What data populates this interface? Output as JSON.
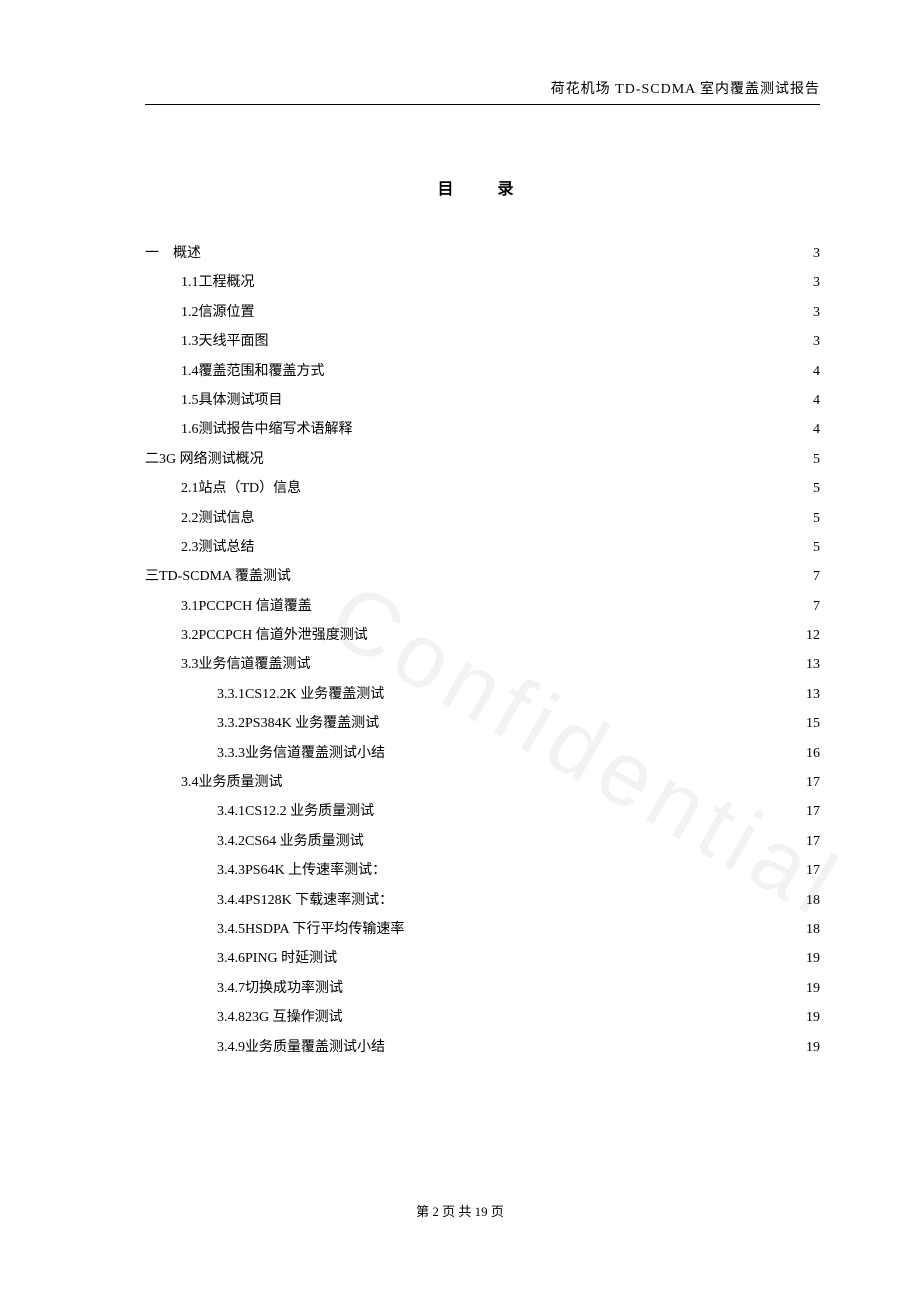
{
  "header": {
    "right_text": "荷花机场 TD-SCDMA 室内覆盖测试报告"
  },
  "toc_title": "目　录",
  "toc": [
    {
      "indent": 0,
      "num": "一",
      "label": "　概述",
      "page": "3"
    },
    {
      "indent": 1,
      "num": "1.1",
      "label": "  工程概况",
      "page": "3"
    },
    {
      "indent": 1,
      "num": "1.2",
      "label": "  信源位置",
      "page": "3"
    },
    {
      "indent": 1,
      "num": "1.3",
      "label": "  天线平面图",
      "page": "3"
    },
    {
      "indent": 1,
      "num": "1.4",
      "label": "  覆盖范围和覆盖方式",
      "page": "4"
    },
    {
      "indent": 1,
      "num": "1.5",
      "label": "  具体测试项目",
      "page": "4"
    },
    {
      "indent": 1,
      "num": "1.6",
      "label": "  测试报告中缩写术语解释",
      "page": "4"
    },
    {
      "indent": 0,
      "num": "二",
      "label": "  3G 网络测试概况",
      "page": "5"
    },
    {
      "indent": 1,
      "num": "2.1",
      "label": " 站点（TD）信息 ",
      "page": "5"
    },
    {
      "indent": 1,
      "num": "2.2",
      "label": " 测试信息",
      "page": "5"
    },
    {
      "indent": 1,
      "num": "2.3",
      "label": " 测试总结",
      "page": "5"
    },
    {
      "indent": 0,
      "num": "三",
      "label": "  TD-SCDMA  覆盖测试",
      "page": "7"
    },
    {
      "indent": 1,
      "num": "3.1",
      "label": " PCCPCH 信道覆盖 ",
      "page": "7"
    },
    {
      "indent": 1,
      "num": "3.2",
      "label": " PCCPCH 信道外泄强度测试 ",
      "page": "12"
    },
    {
      "indent": 1,
      "num": "3.3",
      "label": " 业务信道覆盖测试",
      "page": "13"
    },
    {
      "indent": 2,
      "num": "3.3.1",
      "label": " CS12.2K 业务覆盖测试",
      "page": "13"
    },
    {
      "indent": 2,
      "num": "3.3.2",
      "label": " PS384K 业务覆盖测试 ",
      "page": "15"
    },
    {
      "indent": 2,
      "num": "3.3.3",
      "label": " 业务信道覆盖测试小结",
      "page": "16"
    },
    {
      "indent": 1,
      "num": "3.4",
      "label": "  业务质量测试",
      "page": "17"
    },
    {
      "indent": 2,
      "num": "3.4.1",
      "label": " CS12.2 业务质量测试",
      "page": "17"
    },
    {
      "indent": 2,
      "num": "3.4.2",
      "label": " CS64 业务质量测试",
      "page": "17"
    },
    {
      "indent": 2,
      "num": "3.4.3",
      "label": " PS64K 上传速率测试：",
      "page": "17"
    },
    {
      "indent": 2,
      "num": "3.4.4",
      "label": " PS128K 下载速率测试： ",
      "page": "18"
    },
    {
      "indent": 2,
      "num": "3.4.5",
      "label": " HSDPA 下行平均传输速率 ",
      "page": "18"
    },
    {
      "indent": 2,
      "num": "3.4.6",
      "label": " PING 时延测试",
      "page": "19"
    },
    {
      "indent": 2,
      "num": "3.4.7",
      "label": " 切换成功率测试",
      "page": "19"
    },
    {
      "indent": 2,
      "num": "3.4.8",
      "label": " 23G 互操作测试",
      "page": "19"
    },
    {
      "indent": 2,
      "num": "3.4.9",
      "label": " 业务质量覆盖测试小结",
      "page": "19"
    }
  ],
  "footer": {
    "text": "第  2  页  共  19  页"
  },
  "watermark": "Confidential"
}
